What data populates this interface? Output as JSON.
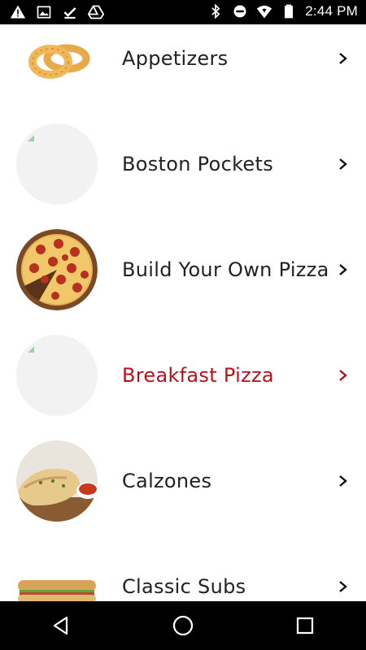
{
  "status_bar": {
    "time": "2:44 PM",
    "left_icons": [
      "warning-icon",
      "image-icon",
      "download-done-icon",
      "drive-icon"
    ],
    "right_icons": [
      "bluetooth-icon",
      "do-not-disturb-icon",
      "wifi-icon",
      "battery-icon"
    ]
  },
  "menu": {
    "items": [
      {
        "label": "Appetizers",
        "image": "onion-rings-image",
        "accent": false
      },
      {
        "label": "Boston Pockets",
        "image": "placeholder",
        "accent": false
      },
      {
        "label": "Build Your Own Pizza",
        "image": "pepperoni-pizza-image",
        "accent": false
      },
      {
        "label": "Breakfast Pizza",
        "image": "placeholder",
        "accent": true
      },
      {
        "label": "Calzones",
        "image": "calzone-image",
        "accent": false
      },
      {
        "label": "Classic Subs",
        "image": "sub-sandwich-image",
        "accent": false
      }
    ]
  },
  "colors": {
    "accent": "#b5121b",
    "text": "#222222",
    "status_bar_bg": "#000000",
    "nav_bar_bg": "#000000"
  },
  "nav_bar": {
    "buttons": [
      "back-icon",
      "home-icon",
      "recents-icon"
    ]
  }
}
